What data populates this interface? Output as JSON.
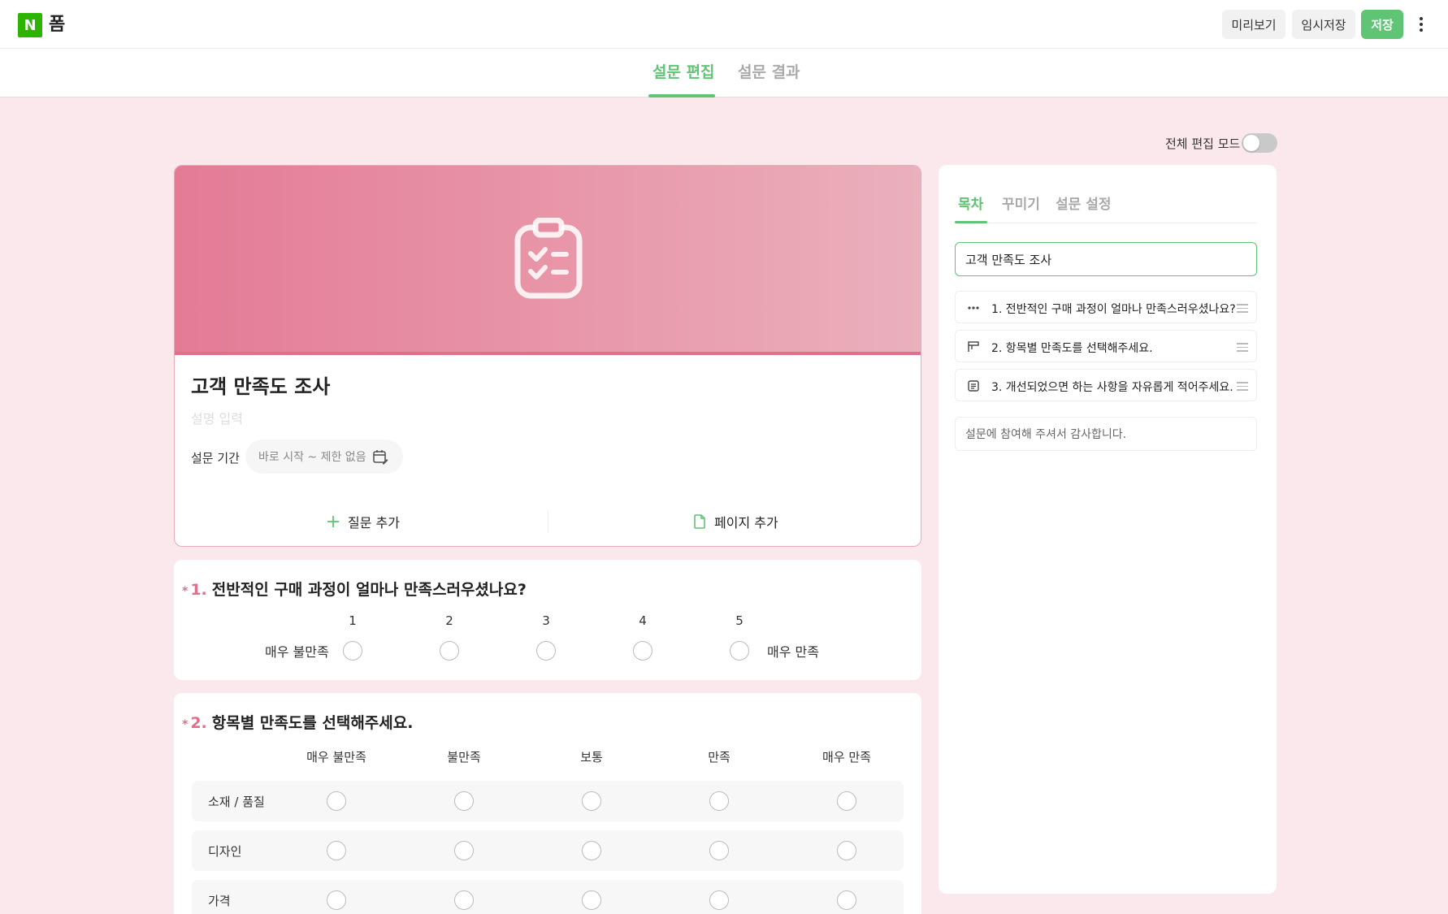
{
  "header": {
    "logo": "N",
    "title": "폼",
    "preview_label": "미리보기",
    "draft_label": "임시저장",
    "save_label": "저장"
  },
  "main_tabs": {
    "edit": "설문 편집",
    "result": "설문 결과",
    "active": "edit"
  },
  "edit_mode": {
    "label": "전체 편집 모드",
    "enabled": false
  },
  "survey": {
    "title": "고객 만족도 조사",
    "description_placeholder": "설명 입력",
    "period_label": "설문 기간",
    "period_value": "바로 시작 ~ 제한 없음",
    "add_question": "질문 추가",
    "add_page": "페이지 추가",
    "banner_color": "#e47b96",
    "accent_color": "#5fc474",
    "required_color": "#e06f89"
  },
  "questions": [
    {
      "required_mark": "*",
      "number": "1.",
      "title": "전반적인 구매 과정이 얼마나 만족스러우셨나요?",
      "scale": [
        "1",
        "2",
        "3",
        "4",
        "5"
      ],
      "min_label": "매우 불만족",
      "max_label": "매우 만족"
    },
    {
      "required_mark": "*",
      "number": "2.",
      "title": "항목별 만족도를 선택해주세요.",
      "columns": [
        "매우 불만족",
        "불만족",
        "보통",
        "만족",
        "매우 만족"
      ],
      "rows": [
        "소재 / 품질",
        "디자인",
        "가격"
      ]
    }
  ],
  "side_panel": {
    "tabs": [
      "목차",
      "꾸미기",
      "설문 설정"
    ],
    "active_tab": "목차",
    "toc_title": "고객 만족도 조사",
    "toc_items": [
      {
        "icon": "dots-icon",
        "label": "1. 전반적인 구매 과정이 얼마나 만족스러우셨나요?"
      },
      {
        "icon": "grid-icon",
        "label": "2. 항목별 만족도를 선택해주세요."
      },
      {
        "icon": "text-icon",
        "label": "3. 개선되었으면 하는 사항을 자유롭게 적어주세요."
      }
    ],
    "footer_text": "설문에 참여해 주셔서 감사합니다."
  }
}
